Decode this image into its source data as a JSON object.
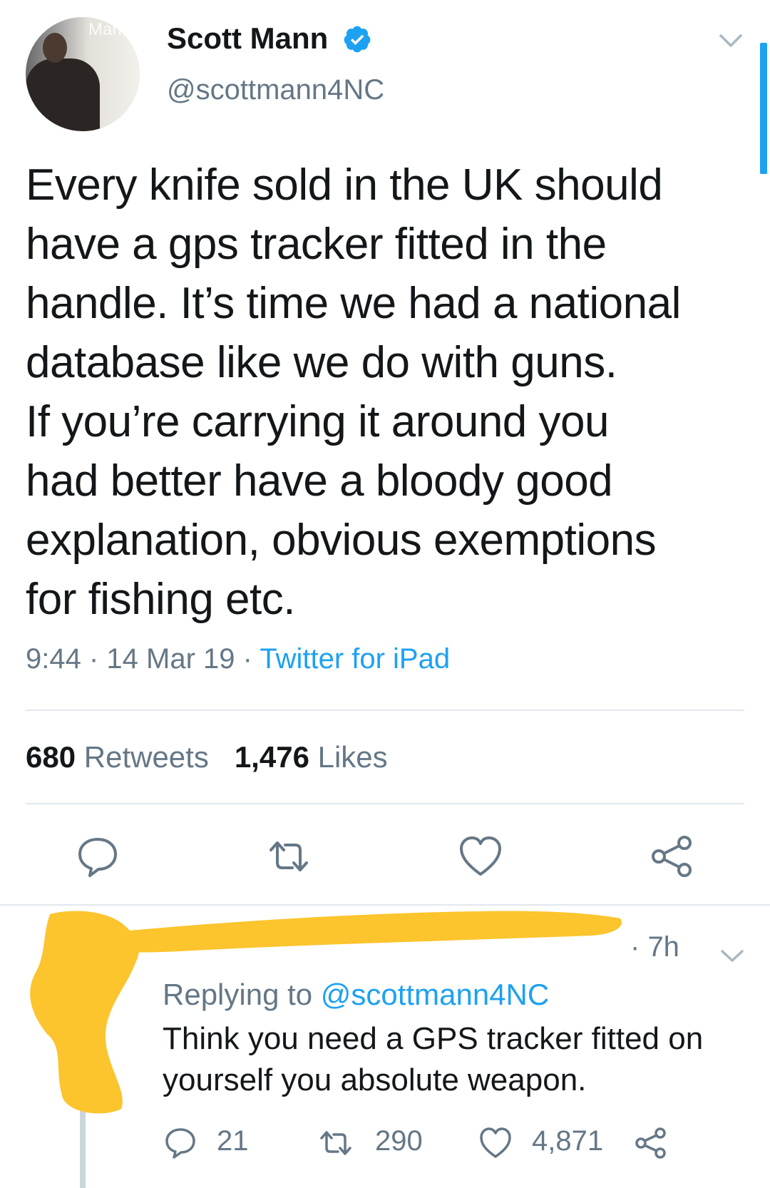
{
  "tweet": {
    "author_name": "Scott Mann",
    "author_handle": "@scottmann4NC",
    "verified": true,
    "avatar_banner_text": "Mann",
    "text_lines": [
      "Every knife sold in the UK should",
      "have a gps tracker fitted in the",
      "handle. It’s time we had a national",
      "database like we do with guns.",
      "If you’re carrying it around you",
      "had better have a bloody good",
      "explanation, obvious exemptions",
      "for fishing etc."
    ],
    "time": "9:44",
    "date": "14 Mar 19",
    "source": "Twitter for iPad",
    "retweet_count": "680",
    "retweet_label": "Retweets",
    "like_count": "1,476",
    "like_label": "Likes"
  },
  "actions": {
    "icons": [
      "reply-icon",
      "retweet-icon",
      "like-icon",
      "share-icon"
    ]
  },
  "reply": {
    "time": "7h",
    "replying_prefix": "Replying to",
    "replying_mention": "@scottmann4NC",
    "text_lines": [
      "Think you need a GPS tracker fitted on",
      "yourself you absolute weapon."
    ],
    "reply_count": "21",
    "retweet_count": "290",
    "like_count": "4,871"
  },
  "colors": {
    "accent": "#1da1f2",
    "secondary_text": "#657786",
    "primary_text": "#14171a",
    "divider": "#e1e8ed",
    "redaction": "#fcc42d"
  }
}
